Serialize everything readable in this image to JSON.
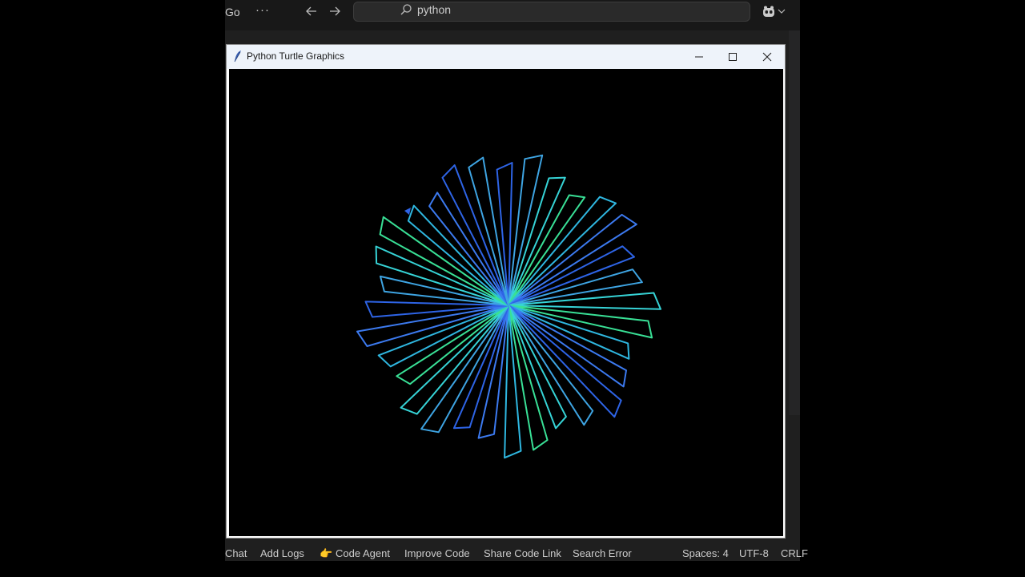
{
  "ide": {
    "menu_go": "Go",
    "more": "···",
    "search_text": "python"
  },
  "turtle_window": {
    "title": "Python Turtle Graphics",
    "background": "#000000",
    "spiral": {
      "zigzags": 32,
      "colors": [
        "#2e64e6",
        "#3ea4e2",
        "#36d3d6",
        "#39e096",
        "#2fb7e0",
        "#3c7af0"
      ]
    }
  },
  "statusbar": {
    "chat": "Chat",
    "add_logs": "Add Logs",
    "code_agent_emoji": "👉",
    "code_agent": "Code Agent",
    "improve_code": "Improve Code",
    "share_code_link": "Share Code Link",
    "search_error": "Search Error",
    "spaces": "Spaces: 4",
    "encoding": "UTF-8",
    "eol": "CRLF"
  }
}
